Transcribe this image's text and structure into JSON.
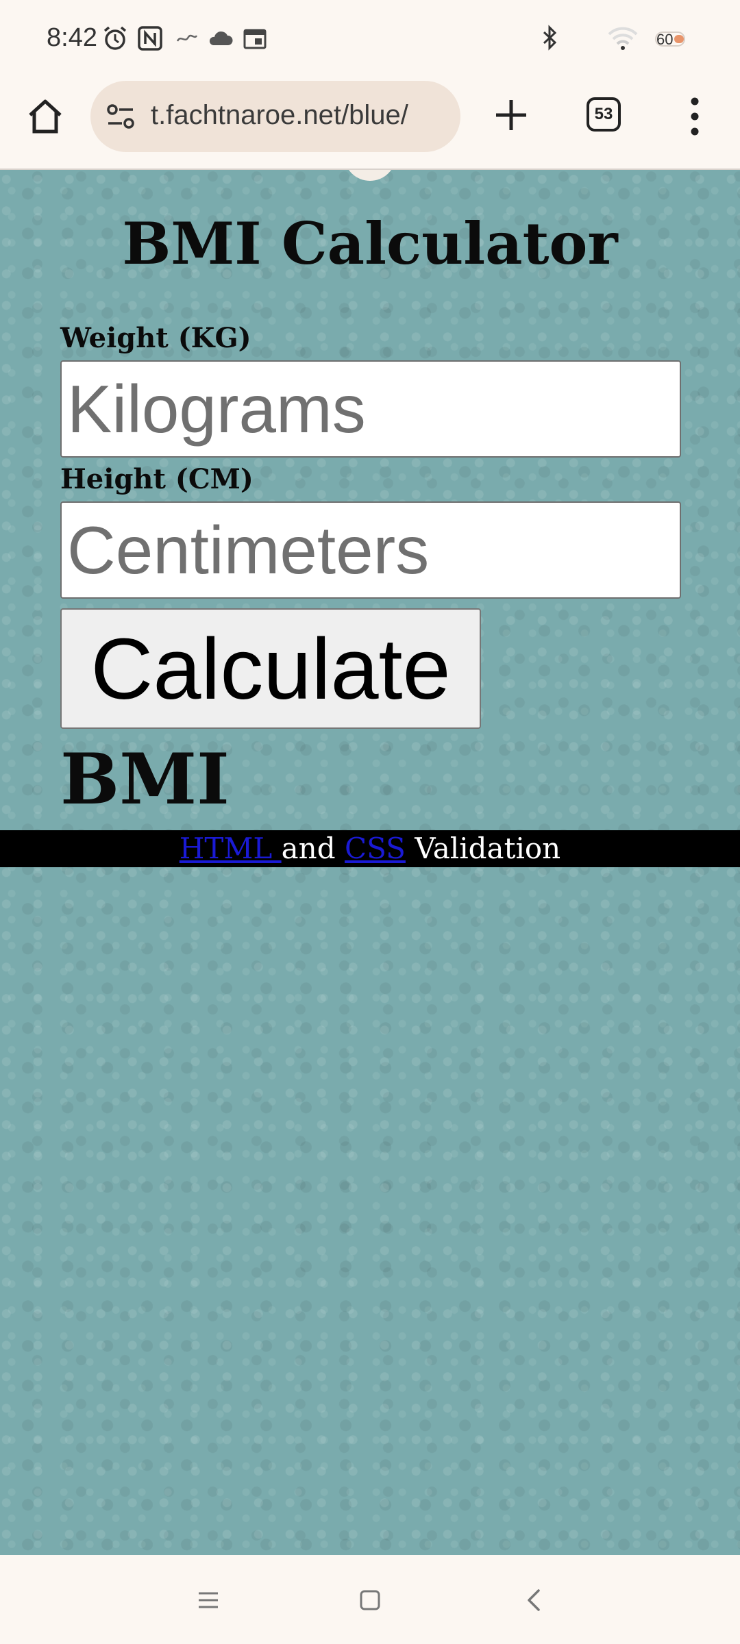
{
  "status_bar": {
    "time": "8:42",
    "battery_level": "60",
    "icons": [
      "alarm-icon",
      "nfc-icon",
      "app-notification-icon",
      "cloud-icon",
      "calendar-icon",
      "bluetooth-icon",
      "wifi-icon",
      "battery-icon"
    ]
  },
  "browser": {
    "url": "t.fachtnaroe.net/blue/",
    "tab_count": "53",
    "icons": [
      "home-icon",
      "site-settings-icon",
      "new-tab-plus-icon",
      "tab-switcher-icon",
      "overflow-menu-icon"
    ]
  },
  "page": {
    "title": "BMI Calculator",
    "weight_label": "Weight (KG)",
    "weight_placeholder": "Kilograms",
    "weight_value": "",
    "height_label": "Height (CM)",
    "height_placeholder": "Centimeters",
    "height_value": "",
    "calculate_label": "Calculate",
    "result_label": "BMI",
    "background_color": "#7aabad"
  },
  "footer": {
    "html_link": "HTML ",
    "and_text": " and ",
    "css_link": "CSS",
    "validation_text": " Validation",
    "link_color": "#1a1ad4"
  },
  "nav_bar": {
    "icons": [
      "recent-apps-icon",
      "home-nav-icon",
      "back-icon"
    ]
  }
}
